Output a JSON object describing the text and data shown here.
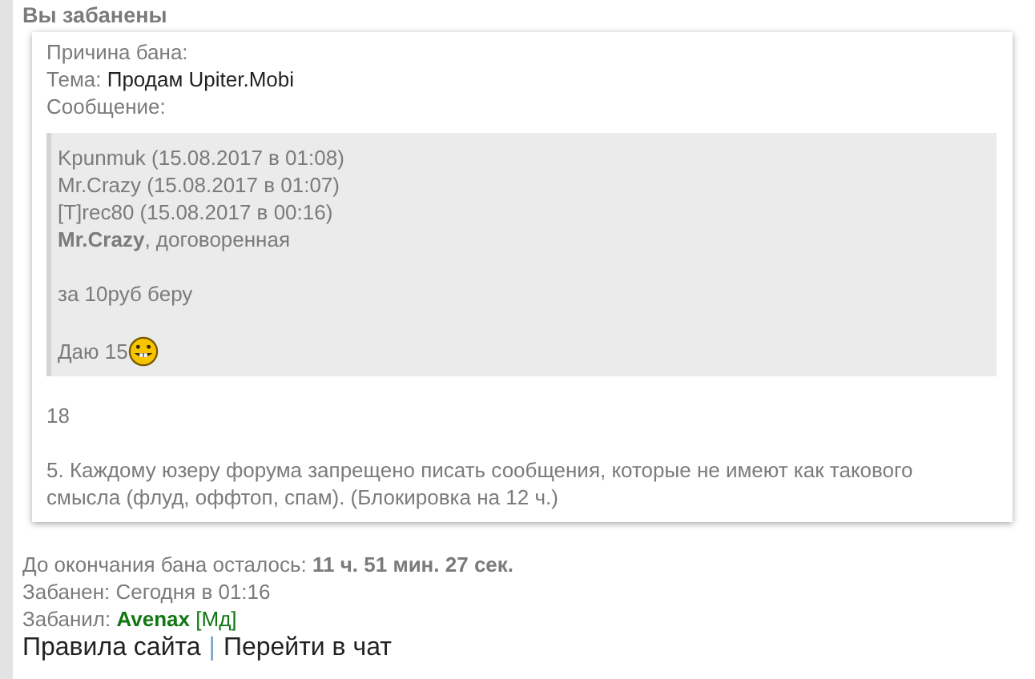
{
  "title": "Вы забанены",
  "reason": {
    "label": "Причина бана:",
    "topic_label": "Тема:",
    "topic": "Продам Upiter.Mobi",
    "message_label": "Сообщение:",
    "quote": [
      {
        "lines": [
          "Kpunmuk (15.08.2017 в 01:08)",
          "Mr.Crazy (15.08.2017 в 01:07)",
          "[T]rec80 (15.08.2017 в 00:16)",
          "**Mr.Crazy**, договоренная"
        ],
        "emoticon": false
      },
      {
        "lines": [
          "за 10руб беру"
        ],
        "emoticon": false
      },
      {
        "lines": [
          "Даю 15"
        ],
        "emoticon": true
      }
    ],
    "after": [
      "18",
      "5. Каждому юзеру форума запрещено писать сообщения, которые не имеют как такового смысла (флуд, оффтоп, спам). (Блокировка на 12 ч.)"
    ]
  },
  "remaining": {
    "label": "До окончания бана осталось:",
    "value": "11 ч. 51 мин. 27 сек."
  },
  "banned_at": "Забанен: Сегодня в 01:16",
  "banned_by": {
    "label": "Забанил:",
    "name": "Avenax",
    "role": "[Мд]"
  },
  "links": [
    "Правила сайта",
    "Перейти в чат"
  ],
  "separator": "|"
}
